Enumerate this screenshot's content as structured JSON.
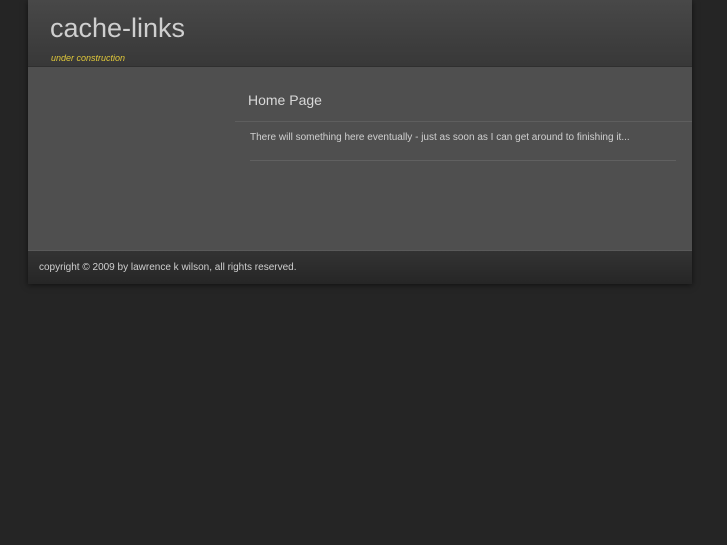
{
  "header": {
    "title": "cache-links",
    "tagline": "under construction"
  },
  "main": {
    "post_title": "Home Page",
    "post_body": "There will something here eventually - just as soon as I can get around to finishing it..."
  },
  "footer": {
    "copyright": "copyright © 2009 by lawrence k wilson, all rights reserved."
  }
}
